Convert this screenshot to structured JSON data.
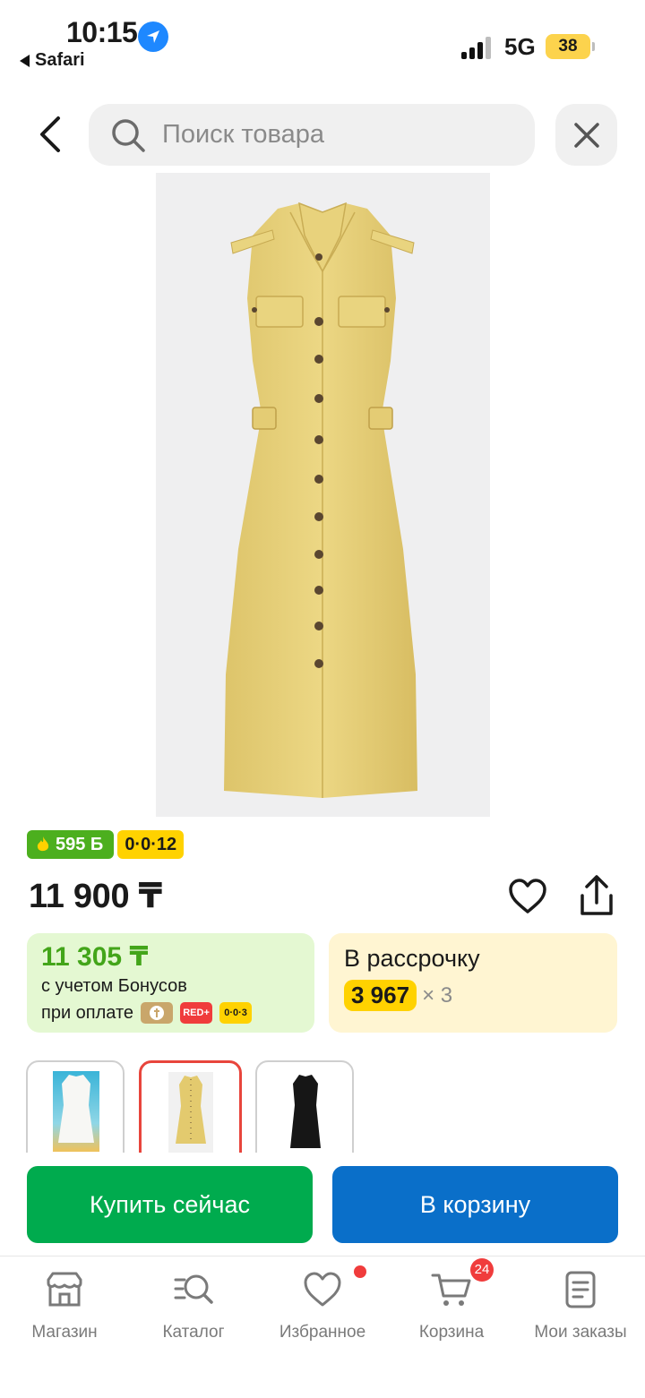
{
  "status_bar": {
    "time": "10:15",
    "back_app": "Safari",
    "network": "5G",
    "battery": "38"
  },
  "search": {
    "placeholder": "Поиск товара",
    "value": ""
  },
  "product": {
    "image_icon": "yellow-dress-image",
    "bonus_badge": "595 Б",
    "installment_badge": "0·0·12",
    "price": "11 900 ₸"
  },
  "bonus_card": {
    "price": "11 305 ₸",
    "line1": "с учетом Бонусов",
    "line2": "при оплате",
    "pay_red": "RED+",
    "pay_003": "0·0·3"
  },
  "installment_card": {
    "title": "В рассрочку",
    "amount": "3 967",
    "multiplier": "× 3"
  },
  "thumbnails": [
    {
      "icon": "white-dress-thumbnail",
      "selected": false
    },
    {
      "icon": "yellow-dress-thumbnail",
      "selected": true
    },
    {
      "icon": "black-dress-thumbnail",
      "selected": false
    }
  ],
  "actions": {
    "buy_now": "Купить сейчас",
    "add_to_cart": "В корзину"
  },
  "tabbar": {
    "items": [
      {
        "label": "Магазин",
        "icon": "store-icon"
      },
      {
        "label": "Каталог",
        "icon": "catalog-search-icon"
      },
      {
        "label": "Избранное",
        "icon": "heart-icon"
      },
      {
        "label": "Корзина",
        "icon": "cart-icon"
      },
      {
        "label": "Мои заказы",
        "icon": "orders-icon"
      }
    ],
    "cart_count": "24"
  },
  "colors": {
    "buy_green": "#00ab4e",
    "cart_blue": "#0a6fc9",
    "bonus_green": "#43a51a",
    "installment_yellow": "#ffd200",
    "badge_red": "#f03c3c"
  }
}
